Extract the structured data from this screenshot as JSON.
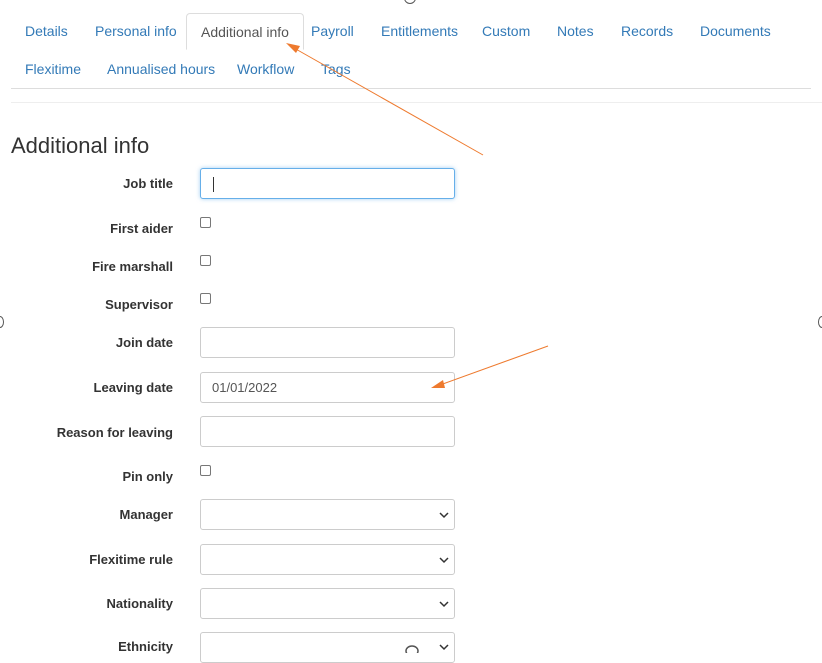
{
  "tabs": [
    {
      "label": "Details",
      "active": false
    },
    {
      "label": "Personal info",
      "active": false
    },
    {
      "label": "Additional info",
      "active": true
    },
    {
      "label": "Payroll",
      "active": false
    },
    {
      "label": "Entitlements",
      "active": false
    },
    {
      "label": "Custom",
      "active": false
    },
    {
      "label": "Notes",
      "active": false
    },
    {
      "label": "Records",
      "active": false
    },
    {
      "label": "Documents",
      "active": false
    },
    {
      "label": "Flexitime",
      "active": false
    },
    {
      "label": "Annualised hours",
      "active": false
    },
    {
      "label": "Workflow",
      "active": false
    },
    {
      "label": "Tags",
      "active": false
    }
  ],
  "page": {
    "title": "Additional info"
  },
  "form": {
    "job_title": {
      "label": "Job title",
      "value": ""
    },
    "first_aider": {
      "label": "First aider",
      "checked": false
    },
    "fire_marshall": {
      "label": "Fire marshall",
      "checked": false
    },
    "supervisor": {
      "label": "Supervisor",
      "checked": false
    },
    "join_date": {
      "label": "Join date",
      "value": ""
    },
    "leaving_date": {
      "label": "Leaving date",
      "value": "01/01/2022"
    },
    "reason_for_leaving": {
      "label": "Reason for leaving",
      "value": ""
    },
    "pin_only": {
      "label": "Pin only",
      "checked": false
    },
    "manager": {
      "label": "Manager",
      "selected": ""
    },
    "flexitime_rule": {
      "label": "Flexitime rule",
      "selected": ""
    },
    "nationality": {
      "label": "Nationality",
      "selected": ""
    },
    "ethnicity": {
      "label": "Ethnicity",
      "selected": ""
    }
  },
  "colors": {
    "link": "#337ab7",
    "annotation_arrow": "#ee7a2e",
    "focus": "#66afe9"
  }
}
